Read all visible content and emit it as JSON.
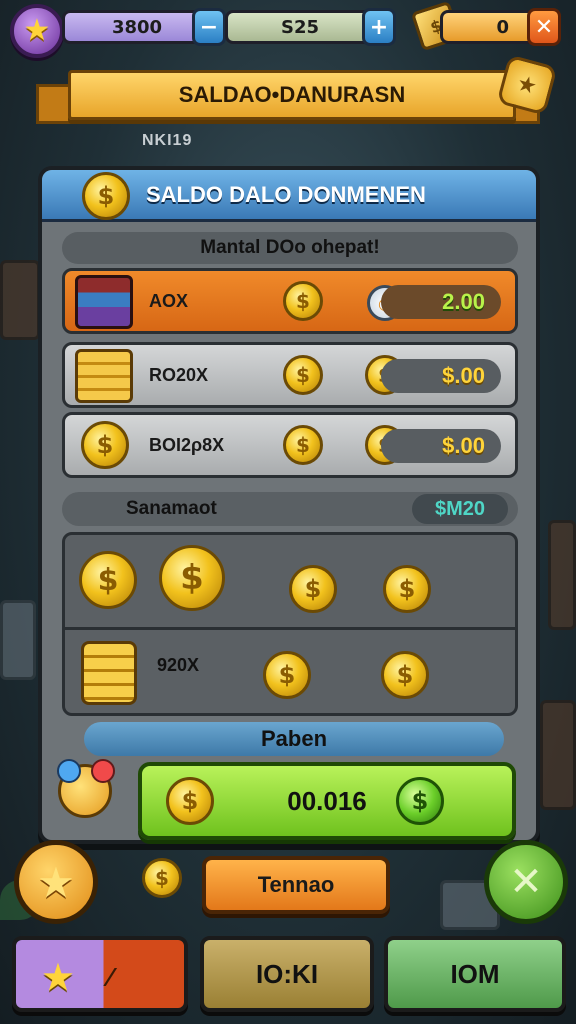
{
  "top": {
    "resource_a": "3800",
    "resource_b": "S25",
    "resource_c": "0",
    "minus_label": "−",
    "plus_label": "+",
    "close_label": "✕"
  },
  "banner": {
    "title": "SALDAO•DANURASN",
    "sublabel": "NKI19"
  },
  "panel": {
    "title": "SALDO DALO DONMENEN",
    "subtitle": "Mantal DOo ohepat!",
    "rows": [
      {
        "label": "AOX",
        "value": "2.00"
      },
      {
        "label": "RO20X",
        "value": "$.00"
      },
      {
        "label": "BOI2ρ8X",
        "value": "$.00"
      }
    ],
    "summary_label": "Sanamaot",
    "summary_value": "$M20",
    "stack_label": "920X",
    "paid_label": "Paben",
    "total_label": "00.016"
  },
  "bottom": {
    "mid_button": "Tennao",
    "btn_mid": "IO:KI",
    "btn_right": "IOM"
  },
  "icons": {
    "coin": "$",
    "star": "★"
  },
  "colors": {
    "accent_orange": "#e47a1c",
    "accent_green": "#7fd02a",
    "panel_header_blue": "#4a8ccc",
    "value_green": "#b9f24a",
    "value_gold": "#ffd43a",
    "summary_teal": "#4fd6c6"
  }
}
